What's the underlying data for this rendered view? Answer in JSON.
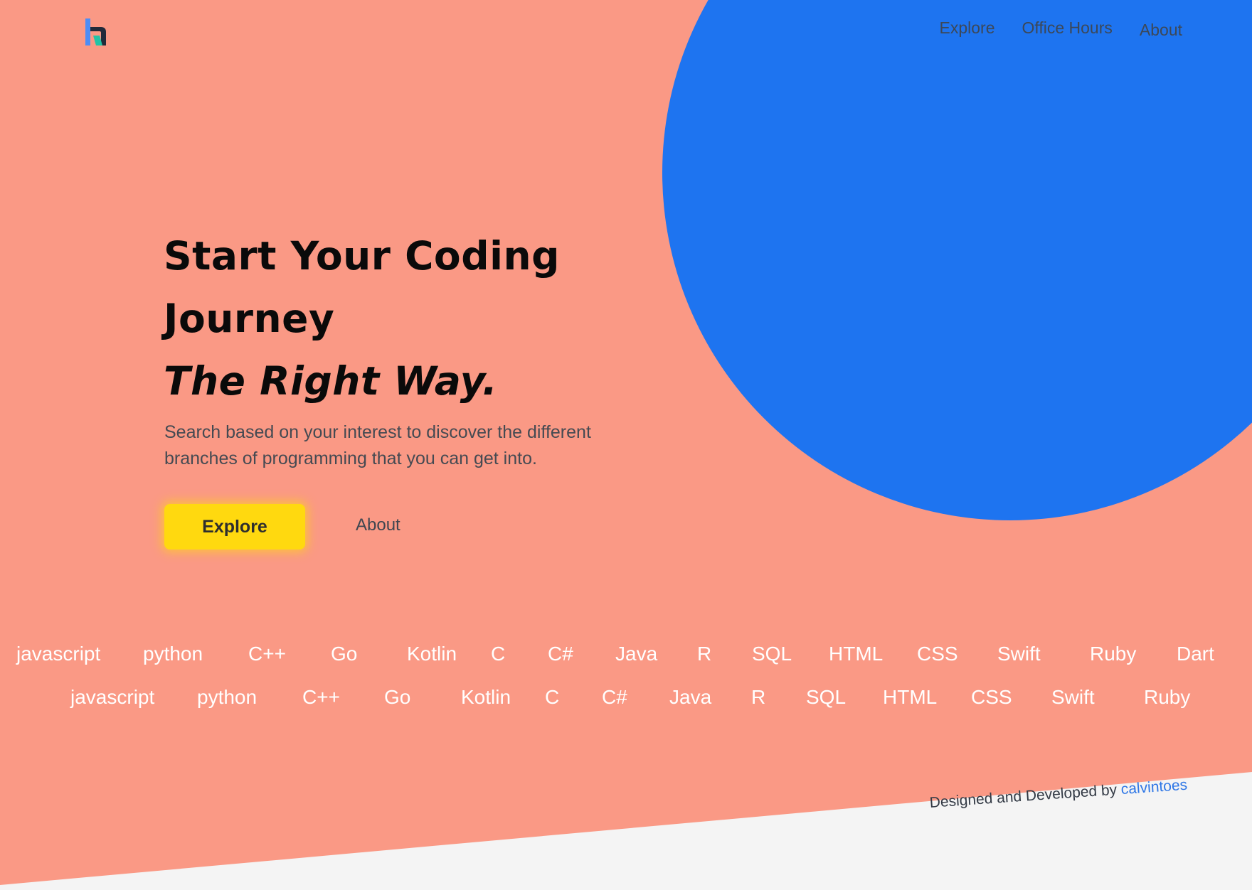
{
  "brand": {
    "logo_icon": "h-letter-logo-icon"
  },
  "nav": {
    "items": [
      "Explore",
      "Office Hours",
      "About"
    ]
  },
  "hero": {
    "title_line1": "Start Your Coding",
    "title_line2": "Journey",
    "title_accent": "The Right Way.",
    "subtitle": "Search based on your interest to discover the different branches of programming that you can get into.",
    "primary_button": "Explore",
    "secondary_link": "About"
  },
  "languages": {
    "row1": [
      "javascript",
      "python",
      "C++",
      "Go",
      "Kotlin",
      "C",
      "C#",
      "Java",
      "R",
      "SQL",
      "HTML",
      "CSS",
      "Swift",
      "Ruby",
      "Dart"
    ],
    "row2": [
      "javascript",
      "python",
      "C++",
      "Go",
      "Kotlin",
      "C",
      "C#",
      "Java",
      "R",
      "SQL",
      "HTML",
      "CSS",
      "Swift",
      "Ruby"
    ]
  },
  "footer": {
    "credit_prefix": "Designed and Developed by",
    "credit_author": "calvintoes"
  },
  "colors": {
    "background": "#fa9985",
    "circle": "#1e74f0",
    "footer_band": "#f4f4f4",
    "cta": "#ffd90f",
    "link": "#2f77e6"
  }
}
